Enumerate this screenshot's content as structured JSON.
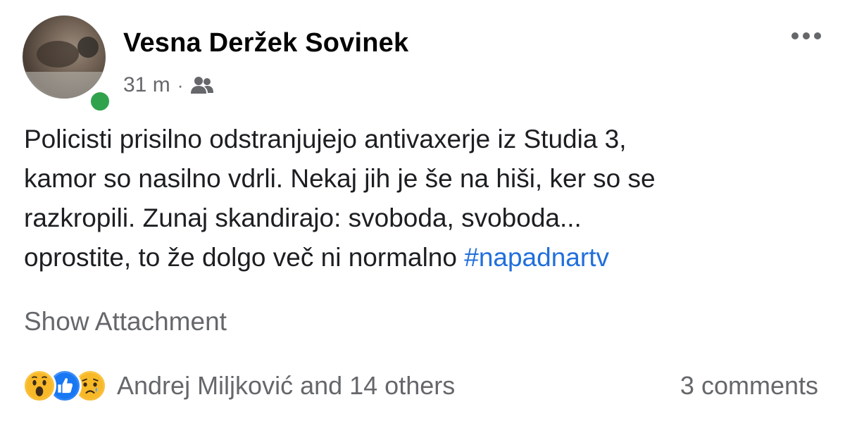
{
  "post": {
    "author_name": "Vesna Deržek Sovinek",
    "timestamp": "31 m",
    "separator": "·",
    "audience_icon": "friends-icon",
    "text_lines": [
      "Policisti prisilno odstranjujejo antivaxerje iz Studia 3,",
      "kamor so nasilno vdrli. Nekaj jih je še na hiši, ker so se",
      "razkropili. Zunaj skandirajo: svoboda, svoboda...",
      "oprostite, to že dolgo več ni normalno "
    ],
    "hashtag": "#napadnartv",
    "show_attachment_label": "Show Attachment",
    "reaction_icons": [
      "wow-reaction-icon",
      "like-reaction-icon",
      "sad-reaction-icon"
    ],
    "reaction_summary": "Andrej Miljković and 14 others",
    "comments_label": "3 comments"
  },
  "colors": {
    "hashtag": "#216fdb",
    "secondary_text": "#65676b",
    "online": "#31a24c"
  }
}
